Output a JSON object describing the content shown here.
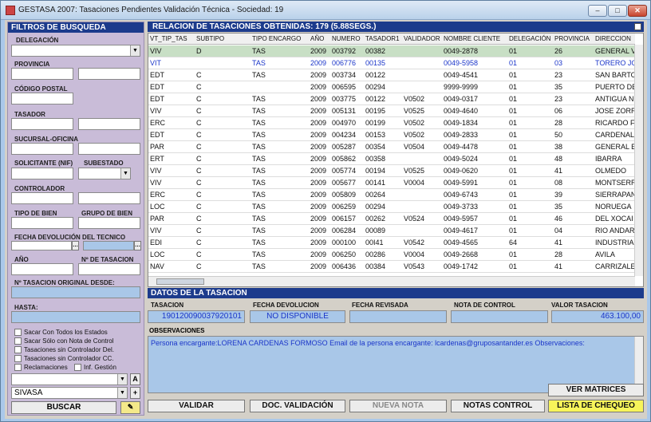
{
  "window": {
    "title": "GESTASA 2007: Tasaciones Pendientes Validación Técnica -  Sociedad: 19"
  },
  "filters": {
    "title": "FILTROS DE BUSQUEDA",
    "delegacion": "DELEGACIÓN",
    "provincia": "PROVINCIA",
    "codigo_postal": "CÓDIGO POSTAL",
    "tasador": "TASADOR",
    "sucursal": "SUCURSAL-OFICINA",
    "solicitante": "SOLICITANTE (NIF)",
    "subestado": "SUBESTADO",
    "controlador": "CONTROLADOR",
    "tipo_bien": "TIPO DE BIEN",
    "grupo_bien": "GRUPO DE BIEN",
    "fecha_dev": "FECHA DEVOLUCIÓN DEL TECNICO",
    "anio": "AÑO",
    "num_tasacion": "Nº DE TASACION",
    "num_original": "Nº TASACION ORIGINAL DESDE:",
    "hasta": "HASTA:",
    "checks": [
      "Sacar Con Todos los Estados",
      "Sacar Sólo con Nota de Control",
      "Tasaciones sin Controlador Del.",
      "Tasaciones sin Controlador CC.",
      "Reclamaciones"
    ],
    "inf_gestion": "Inf. Gestión",
    "a_btn": "A",
    "plus_btn": "+",
    "sivasa": "SIVASA",
    "buscar": "BUSCAR"
  },
  "relacion": {
    "title": "RELACION DE TASACIONES OBTENIDAS: 179 (5.88SEGS.)",
    "headers": [
      "VT_TIP_TAS",
      "SUBTIPO",
      "TIPO ENCARGO",
      "AÑO",
      "NUMERO",
      "TASADOR1",
      "VALIDADOR",
      "NOMBRE CLIENTE",
      "DELEGACIÓN",
      "PROVINCIA",
      "DIRECCION"
    ],
    "rows": [
      [
        "VIV",
        "D",
        "TAS",
        "2009",
        "003792",
        "00382",
        "",
        "0049-2878",
        "01",
        "26",
        "GENERAL V"
      ],
      [
        "VIT",
        "",
        "TAS",
        "2009",
        "006776",
        "00135",
        "",
        "0049-5958",
        "01",
        "03",
        "TORERO JO"
      ],
      [
        "EDT",
        "C",
        "TAS",
        "2009",
        "003734",
        "00122",
        "",
        "0049-4541",
        "01",
        "23",
        "SAN BARTO"
      ],
      [
        "EDT",
        "C",
        "",
        "2009",
        "006595",
        "00294",
        "",
        "9999-9999",
        "01",
        "35",
        "PUERTO DE"
      ],
      [
        "EDT",
        "C",
        "TAS",
        "2009",
        "003775",
        "00122",
        "V0502",
        "0049-0317",
        "01",
        "23",
        "ANTIGUA N"
      ],
      [
        "VIV",
        "C",
        "TAS",
        "2009",
        "005131",
        "00195",
        "V0525",
        "0049-4640",
        "01",
        "06",
        "JOSE ZORR"
      ],
      [
        "ERC",
        "C",
        "TAS",
        "2009",
        "004970",
        "00199",
        "V0502",
        "0049-1834",
        "01",
        "28",
        "RICARDO F"
      ],
      [
        "EDT",
        "C",
        "TAS",
        "2009",
        "004234",
        "00153",
        "V0502",
        "0049-2833",
        "01",
        "50",
        "CARDENAL"
      ],
      [
        "PAR",
        "C",
        "TAS",
        "2009",
        "005287",
        "00354",
        "V0504",
        "0049-4478",
        "01",
        "38",
        "GENERAL E"
      ],
      [
        "ERT",
        "C",
        "TAS",
        "2009",
        "005862",
        "00358",
        "",
        "0049-5024",
        "01",
        "48",
        "IBARRA"
      ],
      [
        "VIV",
        "C",
        "TAS",
        "2009",
        "005774",
        "00194",
        "V0525",
        "0049-0620",
        "01",
        "41",
        "OLMEDO"
      ],
      [
        "VIV",
        "C",
        "TAS",
        "2009",
        "005677",
        "00141",
        "V0004",
        "0049-5991",
        "01",
        "08",
        "MONTSERR"
      ],
      [
        "ERC",
        "C",
        "TAS",
        "2009",
        "005809",
        "00264",
        "",
        "0049-6743",
        "01",
        "39",
        "SIERRAPAN"
      ],
      [
        "LOC",
        "C",
        "TAS",
        "2009",
        "006259",
        "00294",
        "",
        "0049-3733",
        "01",
        "35",
        "NORUEGA"
      ],
      [
        "PAR",
        "C",
        "TAS",
        "2009",
        "006157",
        "00262",
        "V0524",
        "0049-5957",
        "01",
        "46",
        "DEL XOCAI"
      ],
      [
        "VIV",
        "C",
        "TAS",
        "2009",
        "006284",
        "00089",
        "",
        "0049-4617",
        "01",
        "04",
        "RIO ANDAR"
      ],
      [
        "EDI",
        "C",
        "TAS",
        "2009",
        "000100",
        "00I41",
        "V0542",
        "0049-4565",
        "64",
        "41",
        "INDUSTRIA"
      ],
      [
        "LOC",
        "C",
        "TAS",
        "2009",
        "006250",
        "00286",
        "V0004",
        "0049-2668",
        "01",
        "28",
        "AVILA"
      ],
      [
        "NAV",
        "C",
        "TAS",
        "2009",
        "006436",
        "00384",
        "V0543",
        "0049-1742",
        "01",
        "41",
        "CARRIZALE"
      ]
    ]
  },
  "datos": {
    "title": "DATOS DE LA TASACION",
    "tasacion_label": "TASACION",
    "tasacion_val": "190120090037920101",
    "fecha_dev_label": "FECHA DEVOLUCION",
    "fecha_dev_val": "NO DISPONIBLE",
    "fecha_rev_label": "FECHA REVISADA",
    "nota_label": "NOTA DE CONTROL",
    "valor_label": "VALOR TASACION",
    "valor_val": "463.100,00",
    "obs_label": "OBSERVACIONES",
    "obs_text": "Persona encargante:LORENA CARDENAS FORMOSO  Email de la persona encargante: lcardenas@gruposantander.es  Observaciones:"
  },
  "buttons": {
    "ver_matrices": "VER MATRICES",
    "validar": "VALIDAR",
    "doc_validacion": "DOC. VALIDACIÓN",
    "nueva_nota": "NUEVA NOTA",
    "notas_control": "NOTAS CONTROL",
    "lista_chequeo": "LISTA DE CHEQUEO"
  }
}
